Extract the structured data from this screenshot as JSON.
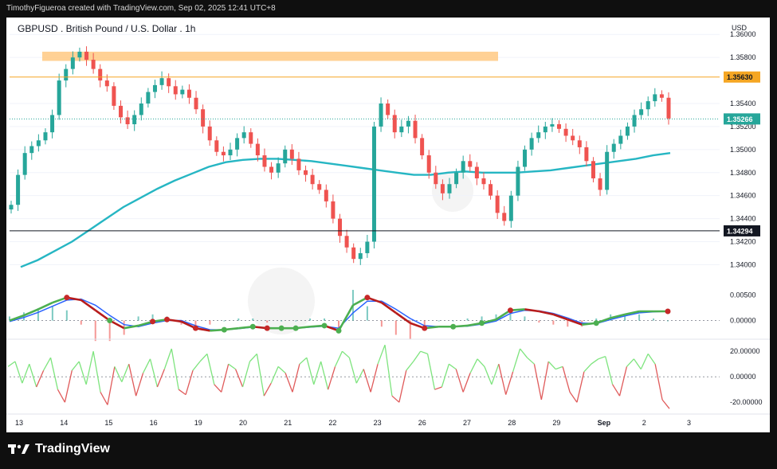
{
  "header": {
    "credit": "TimothyFigueroa created with TradingView.com, Sep 02, 2025 12:41 UTC+8"
  },
  "footer": {
    "brand": "TradingView"
  },
  "colors": {
    "ema": "#26b6c3",
    "zone": "#ffc983",
    "resistance": "#f5a623",
    "price_tag": "#26a69a",
    "bull": "#26a69a",
    "bear": "#ef5350",
    "wave_up": "#4caf50",
    "wave_down": "#b71c1c",
    "osc_up": "#7ee47e",
    "osc_down": "#e05b5b"
  },
  "chart_data": [
    {
      "type": "line",
      "title": "GBPUSD . British Pound / U.S. Dollar . 1h",
      "currency": "USD",
      "x_ticks": [
        "13",
        "14",
        "15",
        "16",
        "19",
        "20",
        "21",
        "22",
        "23",
        "26",
        "27",
        "28",
        "29",
        "Sep",
        "2",
        "3"
      ],
      "y_ticks": [
        "1.36000",
        "1.35800",
        "1.35400",
        "1.35200",
        "1.35000",
        "1.34800",
        "1.34600",
        "1.34400",
        "1.34200",
        "1.34000"
      ],
      "ylim": [
        1.3392,
        1.3605
      ],
      "price_labels": {
        "resistance": "1.35630",
        "last": "1.35266",
        "support": "1.34294"
      },
      "close_series": [
        1.3452,
        1.3478,
        1.3497,
        1.3503,
        1.3508,
        1.3515,
        1.353,
        1.356,
        1.357,
        1.358,
        1.3585,
        1.3578,
        1.357,
        1.356,
        1.3555,
        1.3538,
        1.3528,
        1.3522,
        1.353,
        1.354,
        1.355,
        1.3556,
        1.3562,
        1.3555,
        1.3548,
        1.3552,
        1.3545,
        1.3535,
        1.352,
        1.3508,
        1.3498,
        1.3495,
        1.35,
        1.351,
        1.3515,
        1.3505,
        1.3495,
        1.3485,
        1.348,
        1.3488,
        1.35,
        1.3492,
        1.3482,
        1.3478,
        1.347,
        1.3465,
        1.3455,
        1.344,
        1.3425,
        1.3415,
        1.3405,
        1.341,
        1.342,
        1.352,
        1.354,
        1.353,
        1.3515,
        1.352,
        1.3525,
        1.351,
        1.3495,
        1.348,
        1.347,
        1.3462,
        1.347,
        1.348,
        1.349,
        1.3485,
        1.3475,
        1.347,
        1.346,
        1.3445,
        1.3438,
        1.346,
        1.3485,
        1.35,
        1.351,
        1.3515,
        1.352,
        1.3522,
        1.3518,
        1.3512,
        1.3508,
        1.3502,
        1.349,
        1.3475,
        1.3465,
        1.3498,
        1.3505,
        1.3512,
        1.352,
        1.353,
        1.3535,
        1.3542,
        1.3548,
        1.3545,
        1.3527
      ],
      "ema_series": [
        1.3398,
        1.3404,
        1.3412,
        1.342,
        1.343,
        1.344,
        1.345,
        1.3458,
        1.3466,
        1.3473,
        1.3479,
        1.3485,
        1.3489,
        1.3491,
        1.3492,
        1.3492,
        1.3491,
        1.349,
        1.3488,
        1.3486,
        1.3484,
        1.3482,
        1.348,
        1.3478,
        1.3478,
        1.348,
        1.3481,
        1.348,
        1.348,
        1.348,
        1.3481,
        1.3482,
        1.3484,
        1.3486,
        1.3488,
        1.349,
        1.3492,
        1.3495,
        1.3497
      ],
      "zone": [
        1.3577,
        1.3585
      ],
      "series": [
        {
          "name": "",
          "role": "price"
        },
        {
          "name": "",
          "role": "ema"
        }
      ]
    },
    {
      "type": "line",
      "y_ticks": [
        "0.00500",
        "0.00000"
      ],
      "ylim": [
        -0.0035,
        0.0085
      ],
      "fast": [
        0.0,
        0.001,
        0.0022,
        0.0035,
        0.0045,
        0.004,
        0.002,
        0.0,
        -0.0015,
        -0.001,
        -0.0002,
        0.0002,
        -0.0002,
        -0.0015,
        -0.002,
        -0.0018,
        -0.0015,
        -0.0012,
        -0.0015,
        -0.0015,
        -0.0015,
        -0.0012,
        -0.001,
        -0.002,
        0.003,
        0.0045,
        0.0035,
        0.0015,
        -0.0005,
        -0.0015,
        -0.0012,
        -0.0012,
        -0.001,
        -0.0005,
        0.0002,
        0.002,
        0.0022,
        0.0018,
        0.0012,
        0.0002,
        -0.0008,
        -0.0005,
        0.0005,
        0.0012,
        0.0018,
        0.0018,
        0.0018
      ],
      "slow": [
        -0.0002,
        0.0006,
        0.0016,
        0.0028,
        0.004,
        0.0042,
        0.003,
        0.001,
        -0.0008,
        -0.0012,
        -0.0005,
        0.0,
        0.0,
        -0.001,
        -0.0018,
        -0.0018,
        -0.0016,
        -0.0013,
        -0.0014,
        -0.0015,
        -0.0015,
        -0.0013,
        -0.0011,
        -0.0015,
        0.0015,
        0.0038,
        0.0038,
        0.0022,
        0.0004,
        -0.001,
        -0.0012,
        -0.0012,
        -0.0011,
        -0.0007,
        -0.0001,
        0.0014,
        0.002,
        0.0019,
        0.0014,
        0.0005,
        -0.0005,
        -0.0006,
        0.0002,
        0.0009,
        0.0015,
        0.0017,
        0.0018
      ],
      "markers_red_index": [
        4,
        10,
        11,
        13,
        18,
        25,
        29,
        35,
        46
      ],
      "markers_green_index": [
        7,
        15,
        17,
        19,
        20,
        22,
        23,
        31,
        33,
        41
      ]
    },
    {
      "type": "line",
      "y_ticks": [
        "20.00000",
        "0.00000",
        "-20.00000"
      ],
      "ylim": [
        -28,
        27
      ],
      "values": [
        8,
        12,
        -5,
        10,
        -8,
        5,
        15,
        -10,
        -20,
        5,
        12,
        -6,
        20,
        -12,
        -22,
        8,
        -4,
        10,
        -15,
        3,
        14,
        -8,
        6,
        22,
        -10,
        -14,
        5,
        12,
        18,
        -6,
        -12,
        10,
        6,
        -8,
        12,
        18,
        -15,
        -5,
        8,
        3,
        -12,
        10,
        15,
        -6,
        12,
        -10,
        8,
        20,
        15,
        -5,
        6,
        -12,
        10,
        25,
        -15,
        -20,
        5,
        12,
        20,
        18,
        -10,
        -8,
        10,
        6,
        -12,
        3,
        14,
        8,
        -6,
        10,
        -14,
        4,
        22,
        15,
        10,
        -18,
        12,
        6,
        8,
        -12,
        -20,
        4,
        10,
        14,
        16,
        -6,
        -15,
        8,
        14,
        6,
        18,
        10,
        -18,
        -25
      ]
    }
  ]
}
